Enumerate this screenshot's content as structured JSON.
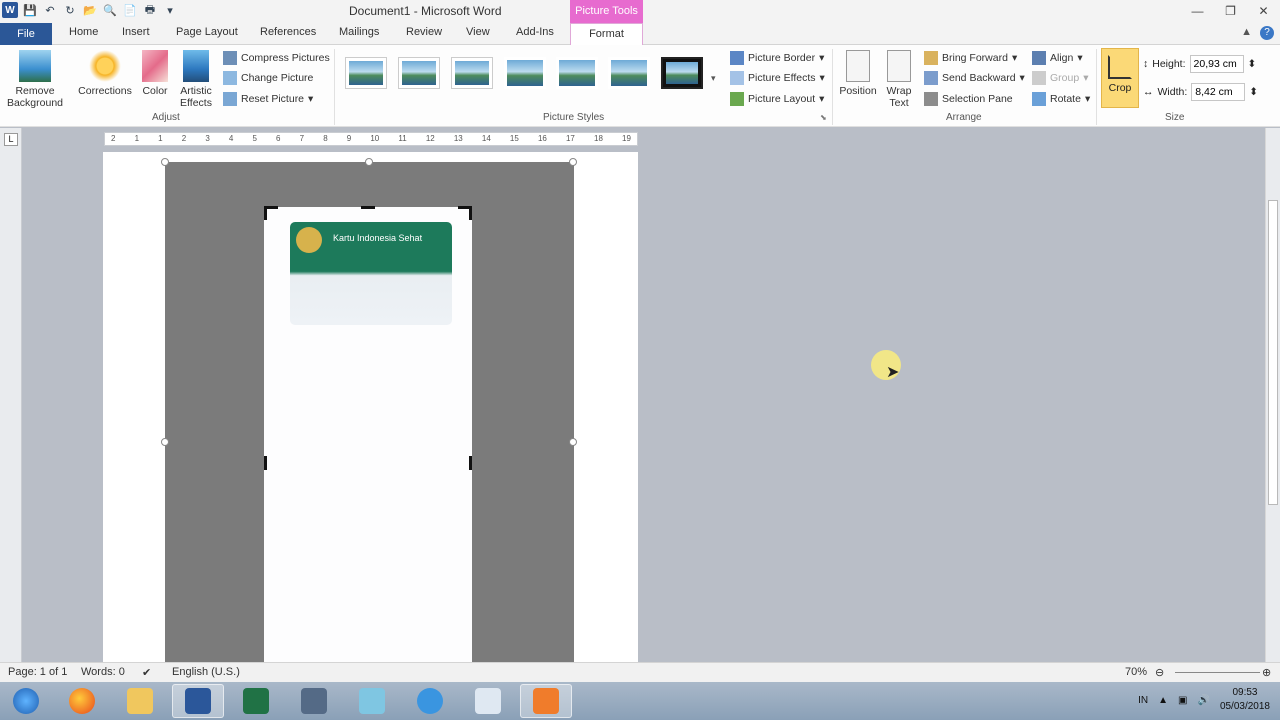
{
  "window": {
    "title": "Document1 - Microsoft Word",
    "context_tab": "Picture Tools"
  },
  "menu": {
    "file": "File",
    "tabs": [
      "Home",
      "Insert",
      "Page Layout",
      "References",
      "Mailings",
      "Review",
      "View",
      "Add-Ins"
    ],
    "active": "Format"
  },
  "ribbon": {
    "adjust": {
      "remove_background": "Remove Background",
      "corrections": "Corrections",
      "color": "Color",
      "artistic_effects": "Artistic Effects",
      "compress": "Compress Pictures",
      "change": "Change Picture",
      "reset": "Reset Picture",
      "label": "Adjust"
    },
    "styles": {
      "label": "Picture Styles",
      "border": "Picture Border",
      "effects": "Picture Effects",
      "layout": "Picture Layout"
    },
    "arrange": {
      "position": "Position",
      "wrap_text": "Wrap Text",
      "bring_forward": "Bring Forward",
      "send_backward": "Send Backward",
      "selection_pane": "Selection Pane",
      "align": "Align",
      "group": "Group",
      "rotate": "Rotate",
      "label": "Arrange"
    },
    "size": {
      "crop": "Crop",
      "height_label": "Height:",
      "height_value": "20,93 cm",
      "width_label": "Width:",
      "width_value": "8,42 cm",
      "label": "Size"
    }
  },
  "ruler": {
    "ticks": [
      "2",
      "1",
      "1",
      "2",
      "3",
      "4",
      "5",
      "6",
      "7",
      "8",
      "9",
      "10",
      "11",
      "12",
      "13",
      "14",
      "15",
      "16",
      "17",
      "18",
      "19"
    ]
  },
  "document": {
    "card_title": "Kartu Indonesia Sehat"
  },
  "status": {
    "page": "Page: 1 of 1",
    "words": "Words: 0",
    "language": "English (U.S.)",
    "zoom": "70%"
  },
  "taskbar": {
    "lang": "IN",
    "time": "09:53",
    "date": "05/03/2018"
  }
}
